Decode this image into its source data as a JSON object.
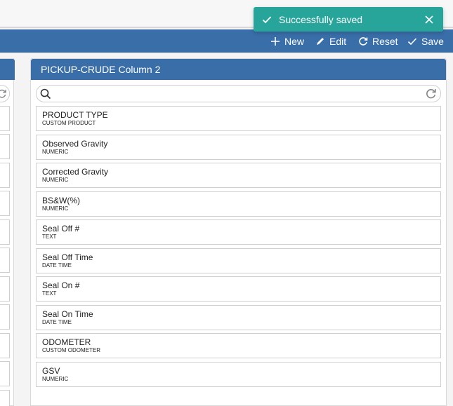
{
  "topbar": {
    "user_text": "..."
  },
  "toolbar": {
    "new_label": "New",
    "edit_label": "Edit",
    "reset_label": "Reset",
    "save_label": "Save"
  },
  "toast": {
    "message": "Successfully saved"
  },
  "panel": {
    "title": "PICKUP-CRUDE Column 2",
    "search_placeholder": "",
    "fields": [
      {
        "name": "PRODUCT TYPE",
        "type": "CUSTOM PRODUCT"
      },
      {
        "name": "Observed Gravity",
        "type": "NUMERIC"
      },
      {
        "name": "Corrected Gravity",
        "type": "NUMERIC"
      },
      {
        "name": "BS&W(%)",
        "type": "NUMERIC"
      },
      {
        "name": "Seal Off #",
        "type": "TEXT"
      },
      {
        "name": "Seal Off Time",
        "type": "DATE TIME"
      },
      {
        "name": "Seal On #",
        "type": "TEXT"
      },
      {
        "name": "Seal On Time",
        "type": "DATE TIME"
      },
      {
        "name": "ODOMETER",
        "type": "CUSTOM ODOMETER"
      },
      {
        "name": "GSV",
        "type": "NUMERIC"
      }
    ]
  },
  "colors": {
    "accent": "#3a6ea9",
    "toast": "#27a59a"
  }
}
